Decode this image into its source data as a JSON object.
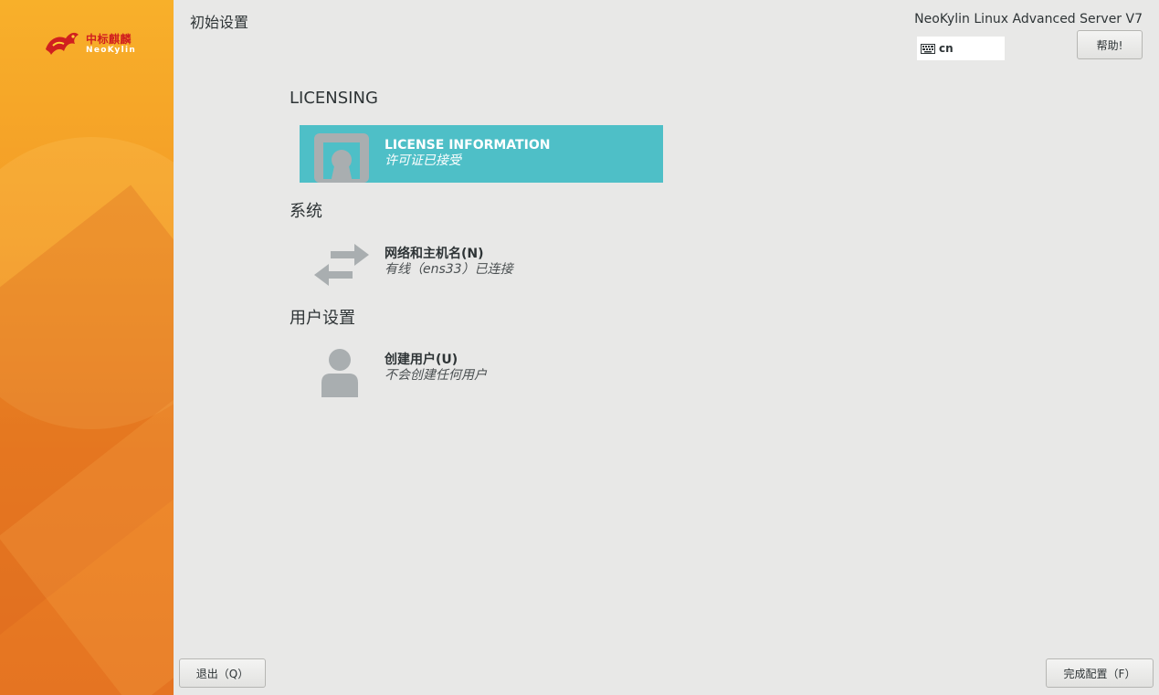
{
  "colors": {
    "accent_selected": "#4ebfc7",
    "sidebar_orange": "#ea7f22",
    "background": "#e8e8e7",
    "logo_red": "#d01f1f"
  },
  "sidebar": {
    "logo_cn": "中标麒麟",
    "logo_en": "NeoKylin",
    "logo_icon": "kylin-logo-icon"
  },
  "header": {
    "title": "初始设置",
    "product": "NeoKylin Linux Advanced Server V7",
    "keyboard_layout": "cn",
    "keyboard_icon": "keyboard-icon",
    "help_label": "帮助!"
  },
  "sections": {
    "licensing": {
      "title": "LICENSING",
      "spokes": [
        {
          "label": "LICENSE INFORMATION",
          "status": "许可证已接受",
          "icon": "license-certificate-icon",
          "selected": true
        }
      ]
    },
    "system": {
      "title": "系统",
      "spokes": [
        {
          "label": "网络和主机名(N)",
          "status": "有线（ens33）已连接",
          "icon": "network-arrows-icon",
          "selected": false
        }
      ]
    },
    "user_settings": {
      "title": "用户设置",
      "spokes": [
        {
          "label": "创建用户(U)",
          "status": "不会创建任何用户",
          "icon": "user-icon",
          "selected": false
        }
      ]
    }
  },
  "footer": {
    "quit_label": "退出（Q）",
    "finish_label": "完成配置（F）"
  }
}
